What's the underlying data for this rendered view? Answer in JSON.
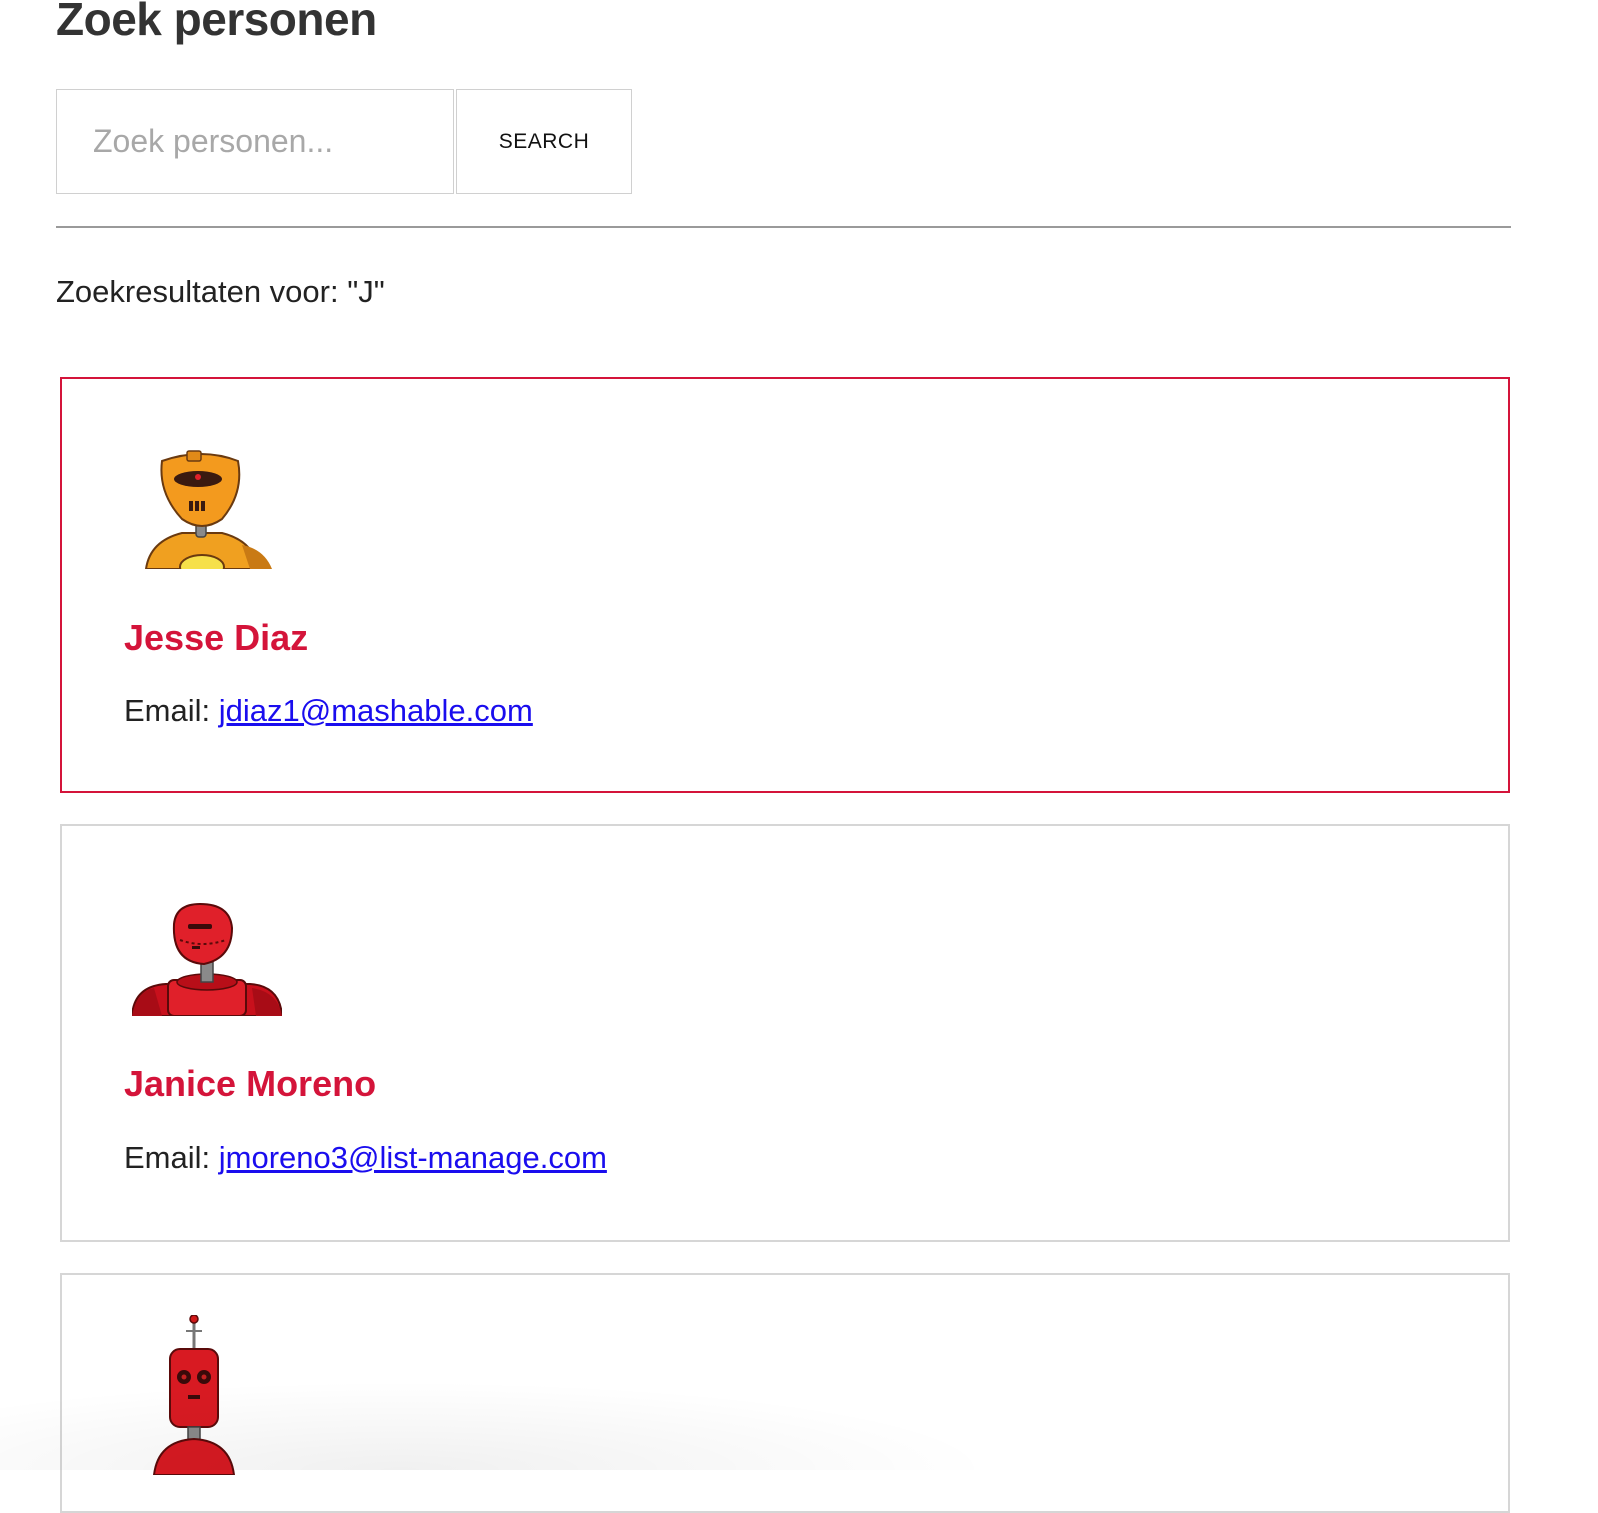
{
  "page": {
    "title": "Zoek personen"
  },
  "search": {
    "placeholder": "Zoek personen...",
    "button_label": "SEARCH"
  },
  "results": {
    "heading": "Zoekresultaten voor: \"J\""
  },
  "colors": {
    "accent": "#d4143a",
    "link": "#1a0dee",
    "border": "#d6d6d6"
  },
  "people": [
    {
      "name": "Jesse Diaz",
      "email_label": "Email:",
      "email": "jdiaz1@mashable.com",
      "avatar": "orange-robot-avatar"
    },
    {
      "name": "Janice Moreno",
      "email_label": "Email:",
      "email": "jmoreno3@list-manage.com",
      "avatar": "red-robot-avatar"
    },
    {
      "avatar": "red-antenna-robot-avatar"
    }
  ]
}
